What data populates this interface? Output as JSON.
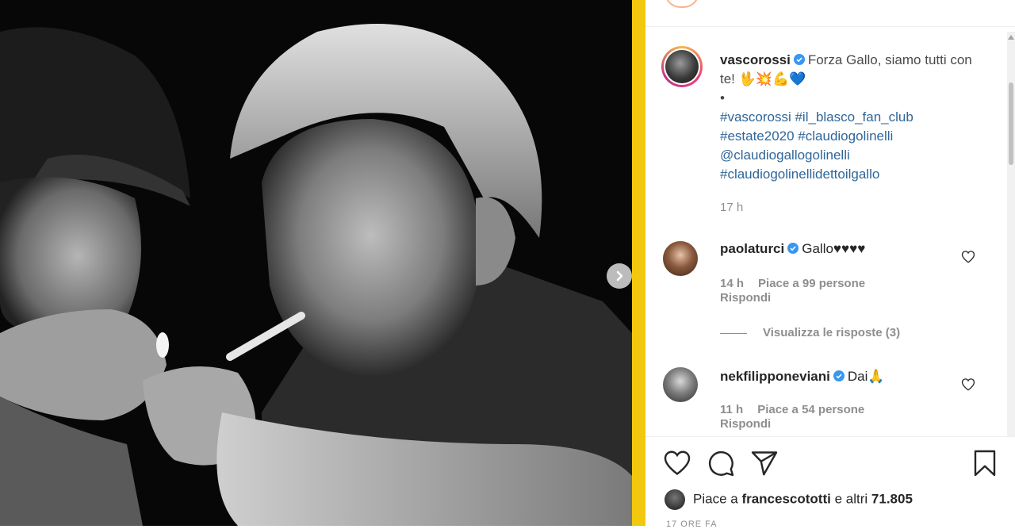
{
  "post": {
    "author": "vascorossi",
    "caption": "Forza Gallo, siamo tutti con te! 🖖💥💪💙",
    "bullet": "•",
    "hashtags": [
      "#vascorossi #il_blasco_fan_club",
      "#estate2020 #claudiogolinelli",
      "@claudiogallogolinelli",
      "#claudiogolinellidettoilgallo"
    ],
    "time": "17 h"
  },
  "comments": [
    {
      "user": "paolaturci",
      "text": "Gallo♥♥♥♥",
      "time": "14 h",
      "likes": "Piace a 99 persone",
      "reply": "Rispondi"
    },
    {
      "user": "nekfilipponeviani",
      "text": "Dai🙏",
      "time": "11 h",
      "likes": "Piace a 54 persone",
      "reply": "Rispondi"
    }
  ],
  "view_replies": "Visualizza le risposte (3)",
  "likes_bar": {
    "prefix": "Piace a",
    "user": "francescototti",
    "middle": "e altri",
    "count": "71.805"
  },
  "post_age": "17 ORE FA",
  "colors": {
    "accent_bar": "#f2c80f",
    "link": "#2f6699",
    "verified": "#3897f0",
    "muted": "#8e8e8e"
  },
  "icons": [
    "chevron-right-icon",
    "verified-icon",
    "heart-icon",
    "comment-icon",
    "share-icon",
    "bookmark-icon"
  ]
}
